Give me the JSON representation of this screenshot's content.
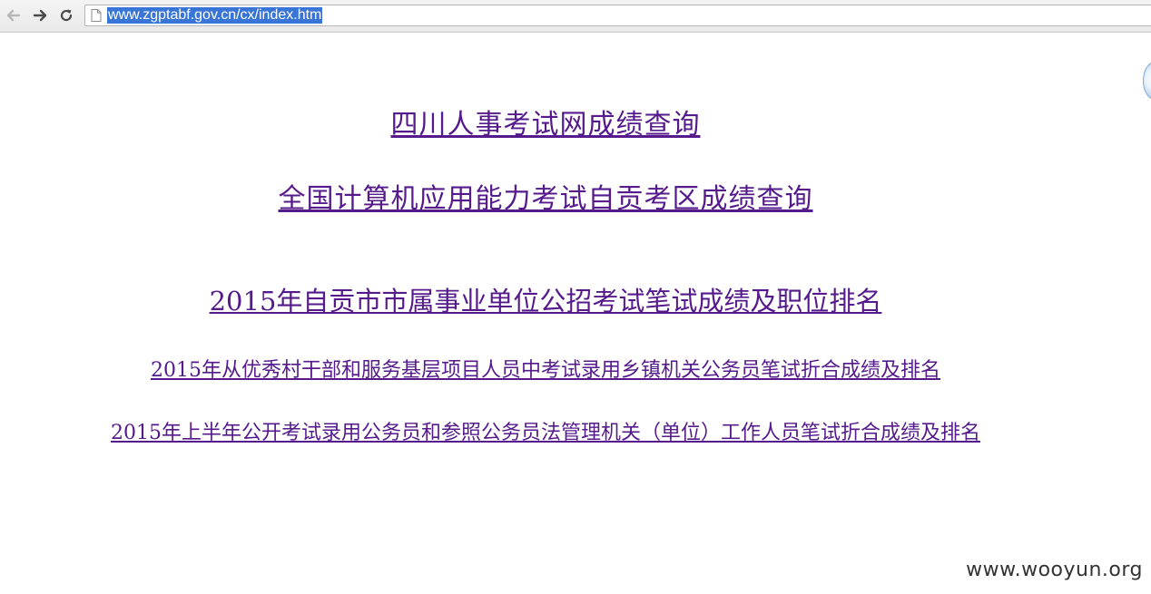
{
  "browser": {
    "url": "www.zgptabf.gov.cn/cx/index.htm",
    "back_icon": "arrow-left-icon",
    "forward_icon": "arrow-right-icon",
    "reload_icon": "reload-icon",
    "page_icon": "document-icon"
  },
  "links": [
    {
      "text": "四川人事考试网成绩查询"
    },
    {
      "text": "全国计算机应用能力考试自贡考区成绩查询"
    },
    {
      "text": "2015年自贡市市属事业单位公招考试笔试成绩及职位排名"
    },
    {
      "text": "2015年从优秀村干部和服务基层项目人员中考试录用乡镇机关公务员笔试折合成绩及排名"
    },
    {
      "text": "2015年上半年公开考试录用公务员和参照公务员法管理机关（单位）工作人员笔试折合成绩及排名"
    }
  ],
  "watermark": "www.wooyun.org",
  "colors": {
    "visited_link": "#551a8b",
    "url_selection": "#3875d7"
  }
}
